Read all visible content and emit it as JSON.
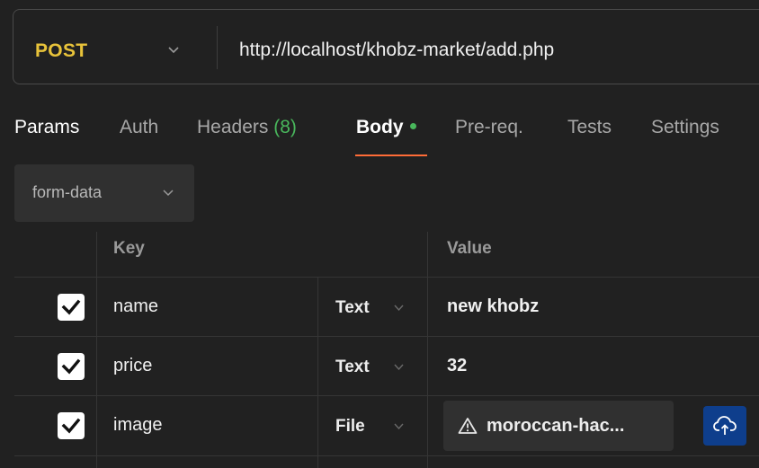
{
  "request": {
    "method": "POST",
    "url": "http://localhost/khobz-market/add.php"
  },
  "tabs": [
    {
      "label": "Params"
    },
    {
      "label": "Auth"
    },
    {
      "label": "Headers",
      "count": "(8)"
    },
    {
      "label": "Body"
    },
    {
      "label": "Pre-req."
    },
    {
      "label": "Tests"
    },
    {
      "label": "Settings"
    }
  ],
  "active_tab": "Body",
  "body_mode": "form-data",
  "table": {
    "headers": {
      "key": "Key",
      "value": "Value"
    },
    "rows": [
      {
        "checked": true,
        "key": "name",
        "type": "Text",
        "value": "new khobz"
      },
      {
        "checked": true,
        "key": "price",
        "type": "Text",
        "value": "32"
      },
      {
        "checked": true,
        "key": "image",
        "type": "File",
        "value": "moroccan-hac..."
      }
    ]
  },
  "colors": {
    "method": "#e8c33a",
    "active_tab_underline": "#ff6c37",
    "body_dot": "#49b75c",
    "header_count": "#49b75c",
    "upload_button": "#0e3e8c"
  },
  "icons": {
    "method_dropdown": "chevron-down-icon",
    "mode_dropdown": "chevron-down-icon",
    "type_dropdown": "chevron-down-icon",
    "checkbox": "check-icon",
    "file_warning": "warning-icon",
    "upload": "cloud-upload-icon"
  }
}
